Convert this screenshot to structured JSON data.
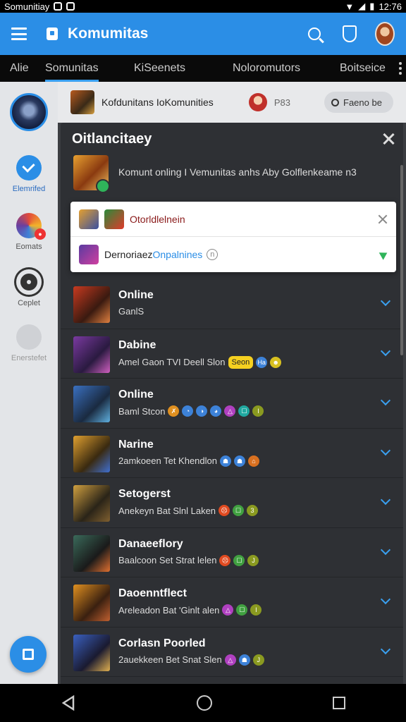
{
  "status_bar": {
    "left_text": "Somunitiay",
    "time": "12:76"
  },
  "app_bar": {
    "title": "Komumitas"
  },
  "tabs": [
    {
      "label": "Alie"
    },
    {
      "label": "Somunitas"
    },
    {
      "label": "KiSeenets"
    },
    {
      "label": "Noloromutors"
    },
    {
      "label": "Boitseice"
    }
  ],
  "sidebar": {
    "items": [
      {
        "label": ""
      },
      {
        "label": "Elemrifed"
      },
      {
        "label": "Eomats"
      },
      {
        "label": "Ceplet"
      },
      {
        "label": "Enerstefet"
      }
    ]
  },
  "subheader": {
    "title": "Kofdunitans IoKomunities",
    "count": "P83",
    "search_label": "Faeno be"
  },
  "panel": {
    "title": "Oitlancitaey",
    "feature_text": "Komunt onling I Vemunitas anhs Aby Golflenkeame n3"
  },
  "popup": {
    "row1_label": "Otorldlelnein",
    "row2_prefix": "Dernoriaez",
    "row2_highlight": "Onpalnines",
    "row2_badge": "n"
  },
  "list": [
    {
      "name": "Online",
      "sub": "GanlS",
      "chips": []
    },
    {
      "name": "Dabine",
      "sub": "Amel Gaon TVI Deell Slon",
      "pill": "Seon",
      "chips": [
        {
          "t": "Ha",
          "c": "#3d82d8"
        },
        {
          "t": "☻",
          "c": "#d8c020"
        }
      ]
    },
    {
      "name": "Online",
      "sub": "Baml Stcon",
      "chips": [
        {
          "t": "✗",
          "c": "#e09020"
        },
        {
          "t": "◔",
          "c": "#3d82d8"
        },
        {
          "t": "◑",
          "c": "#3d82d8"
        },
        {
          "t": "◕",
          "c": "#3d82d8"
        },
        {
          "t": "△",
          "c": "#b040c0"
        },
        {
          "t": "☐",
          "c": "#20a8a0"
        },
        {
          "t": "I",
          "c": "#8a9a20"
        }
      ]
    },
    {
      "name": "Narine",
      "sub": "2amkoeen Tet Khendlon",
      "chips": [
        {
          "t": "☗",
          "c": "#3d82d8"
        },
        {
          "t": "☗",
          "c": "#3d82d8"
        },
        {
          "t": "⌂",
          "c": "#d87020"
        }
      ]
    },
    {
      "name": "Setogerst",
      "sub": "Anekeyn Bat Slnl Laken",
      "chips": [
        {
          "t": "☹",
          "c": "#e04a20"
        },
        {
          "t": "☐",
          "c": "#40a040"
        },
        {
          "t": "3",
          "c": "#8a9a20"
        }
      ]
    },
    {
      "name": "Danaeeflory",
      "sub": "Baalcoon Set Strat lelen",
      "chips": [
        {
          "t": "☹",
          "c": "#e04a20"
        },
        {
          "t": "☐",
          "c": "#40a040"
        },
        {
          "t": "J",
          "c": "#8a9a20"
        }
      ]
    },
    {
      "name": "Daoenntflect",
      "sub": "Areleadon Bat 'Ginlt alen",
      "chips": [
        {
          "t": "△",
          "c": "#b040c0"
        },
        {
          "t": "☐",
          "c": "#40a040"
        },
        {
          "t": "I",
          "c": "#8a9a20"
        }
      ]
    },
    {
      "name": "Corlasn Poorled",
      "sub": "2auekkeen Bet Snat Slen",
      "chips": [
        {
          "t": "△",
          "c": "#b040c0"
        },
        {
          "t": "☗",
          "c": "#3d82d8"
        },
        {
          "t": "J",
          "c": "#8a9a20"
        }
      ]
    }
  ],
  "colors": {
    "accent": "#2b8ee6",
    "panel_bg": "#2e3034",
    "rail_bg": "#e3e5e8"
  }
}
